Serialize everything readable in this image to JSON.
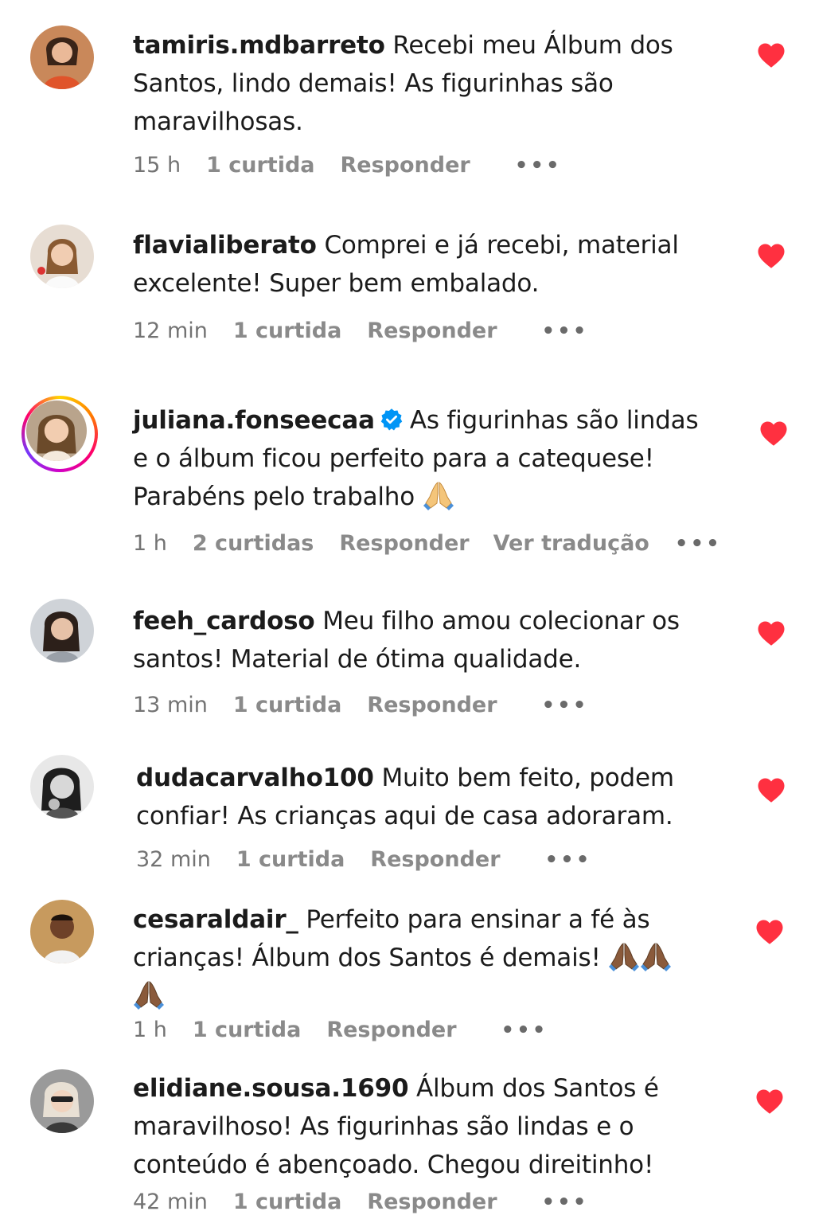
{
  "comments": [
    {
      "username": "tamiris.mdbarreto",
      "text": "Recebi meu Álbum dos Santos, lindo demais! As figurinhas são maravilhosas.",
      "time": "15 h",
      "likes": "1 curtida",
      "reply": "Responder",
      "more": "•••"
    },
    {
      "username": "flavialiberato",
      "text": "Comprei e já recebi, material excelente! Super bem embalado.",
      "time": "12 min",
      "likes": "1 curtida",
      "reply": "Responder",
      "more": "•••"
    },
    {
      "username": "juliana.fonseecaa",
      "verified": true,
      "text": "As figurinhas são lindas e o álbum ficou perfeito para a catequese! Parabéns pelo trabalho",
      "emoji": "folded-hands-icon",
      "time": "1 h",
      "likes": "2 curtidas",
      "reply": "Responder",
      "translate": "Ver tradução",
      "more": "•••"
    },
    {
      "username": "feeh_cardoso",
      "text": "Meu filho amou colecionar os santos! Material de ótima qualidade.",
      "time": "13 min",
      "likes": "1 curtida",
      "reply": "Responder",
      "more": "•••"
    },
    {
      "username": "dudacarvalho100",
      "text": "Muito bem feito, podem confiar! As crianças aqui de casa adoraram.",
      "time": "32 min",
      "likes": "1 curtida",
      "reply": "Responder",
      "more": "•••"
    },
    {
      "username": "cesaraldair_",
      "text": "Perfeito para ensinar a fé às crianças! Álbum dos Santos é demais!",
      "emoji": "folded-hands-icon",
      "time": "1 h",
      "likes": "1 curtida",
      "reply": "Responder",
      "more": "•••"
    },
    {
      "username": "elidiane.sousa.1690",
      "text": "Álbum dos Santos é maravilhoso! As figurinhas são lindas e o conteúdo é abençoado. Chegou direitinho!",
      "time": "42 min",
      "likes": "1 curtida",
      "reply": "Responder",
      "more": "•••"
    }
  ],
  "colors": {
    "heart": "#ff3040",
    "meta": "#737373",
    "verified": "#0095f6"
  }
}
